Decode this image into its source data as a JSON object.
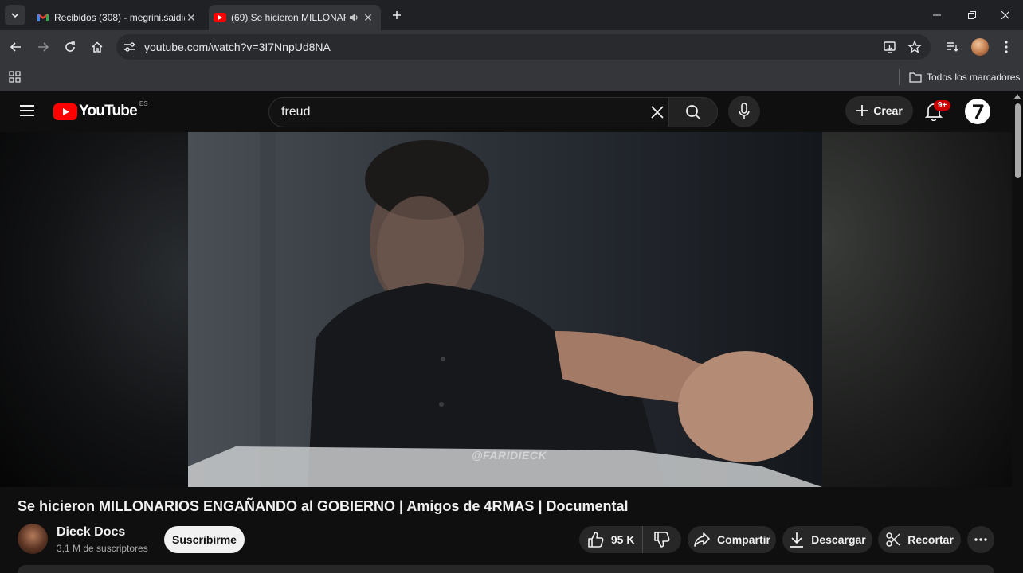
{
  "browser": {
    "tabs": [
      {
        "title": "Recibidos (308) - megrini.saidi@",
        "favicon": "gmail-icon"
      },
      {
        "title": "(69) Se hicieron MILLONARI",
        "favicon": "youtube-icon",
        "audio": true
      }
    ],
    "url": "youtube.com/watch?v=3I7NnpUd8NA",
    "bookmarks_label": "Todos los marcadores"
  },
  "youtube": {
    "logo_text": "YouTube",
    "region": "ES",
    "search_value": "freud",
    "create_label": "Crear",
    "notification_count": "9+"
  },
  "video": {
    "watermark": "@FARIDIECK",
    "title": "Se hicieron MILLONARIOS ENGAÑANDO al GOBIERNO | Amigos de 4RMAS | Documental"
  },
  "channel": {
    "name": "Dieck Docs",
    "subscribers": "3,1 M de suscriptores",
    "subscribe_label": "Suscribirme"
  },
  "actions": {
    "likes": "95 K",
    "share_label": "Compartir",
    "download_label": "Descargar",
    "clip_label": "Recortar"
  },
  "colors": {
    "youtube_red": "#ff0000",
    "badge_red": "#cc0000",
    "tab_strip": "#202124",
    "toolbar": "#35363a",
    "page_bg": "#0f0f0f"
  }
}
